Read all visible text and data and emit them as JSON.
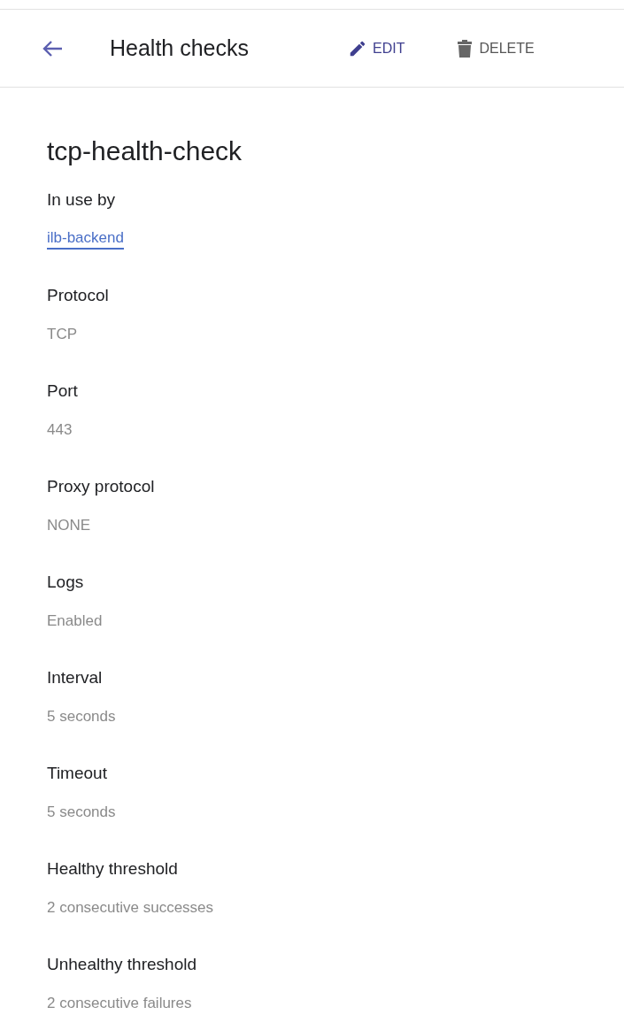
{
  "header": {
    "title": "Health checks",
    "actions": [
      {
        "kind": "edit",
        "label": "EDIT"
      },
      {
        "kind": "delete",
        "label": "DELETE"
      }
    ]
  },
  "name": "tcp-health-check",
  "fields": [
    {
      "label": "In use by",
      "value": "ilb-backend",
      "kind": "link"
    },
    {
      "label": "Protocol",
      "value": "TCP",
      "kind": "text"
    },
    {
      "label": "Port",
      "value": "443",
      "kind": "text"
    },
    {
      "label": "Proxy protocol",
      "value": "NONE",
      "kind": "text"
    },
    {
      "label": "Logs",
      "value": "Enabled",
      "kind": "text"
    },
    {
      "label": "Interval",
      "value": "5 seconds",
      "kind": "text"
    },
    {
      "label": "Timeout",
      "value": "5 seconds",
      "kind": "text"
    },
    {
      "label": "Healthy threshold",
      "value": "2 consecutive successes",
      "kind": "text"
    },
    {
      "label": "Unhealthy threshold",
      "value": "2 consecutive failures",
      "kind": "text"
    }
  ]
}
